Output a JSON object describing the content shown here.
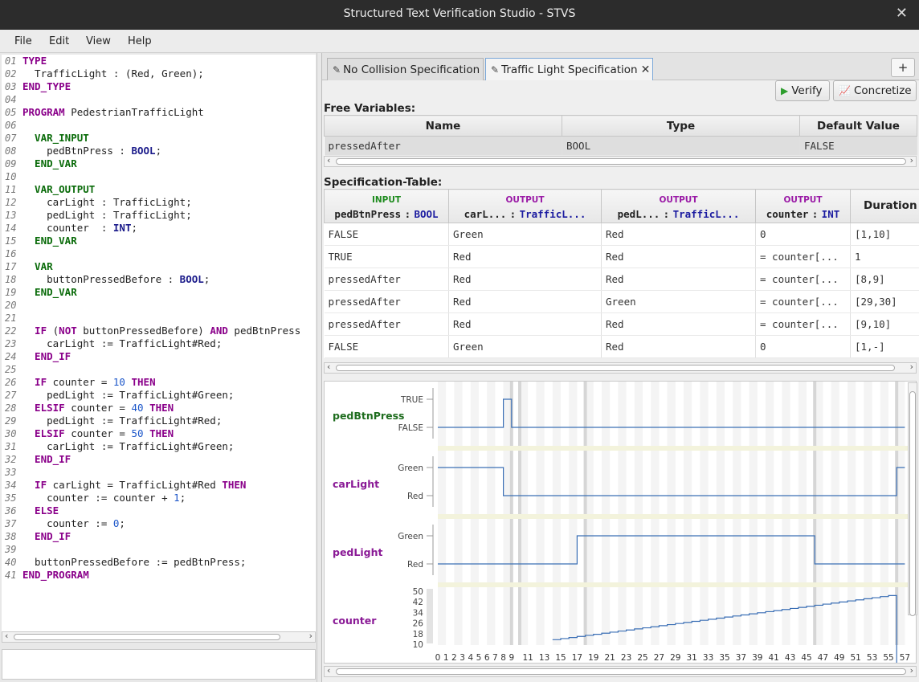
{
  "window": {
    "title": "Structured Text Verification Studio - STVS",
    "close_glyph": "✕"
  },
  "menu": [
    "File",
    "Edit",
    "View",
    "Help"
  ],
  "editor": {
    "lines": [
      [
        [
          "kw2",
          "TYPE"
        ]
      ],
      [
        [
          "",
          "  TrafficLight : (Red, Green);"
        ]
      ],
      [
        [
          "kw2",
          "END_TYPE"
        ]
      ],
      [
        [
          "",
          ""
        ]
      ],
      [
        [
          "kw2",
          "PROGRAM "
        ],
        [
          "",
          "PedestrianTrafficLight"
        ]
      ],
      [
        [
          "",
          ""
        ]
      ],
      [
        [
          "kw",
          "  VAR_INPUT"
        ]
      ],
      [
        [
          "",
          "    pedBtnPress : "
        ],
        [
          "ty",
          "BOOL"
        ],
        [
          "",
          ";"
        ]
      ],
      [
        [
          "kw",
          "  END_VAR"
        ]
      ],
      [
        [
          "",
          ""
        ]
      ],
      [
        [
          "kw",
          "  VAR_OUTPUT"
        ]
      ],
      [
        [
          "",
          "    carLight : TrafficLight;"
        ]
      ],
      [
        [
          "",
          "    pedLight : TrafficLight;"
        ]
      ],
      [
        [
          "",
          "    counter  : "
        ],
        [
          "ty",
          "INT"
        ],
        [
          "",
          ";"
        ]
      ],
      [
        [
          "kw",
          "  END_VAR"
        ]
      ],
      [
        [
          "",
          ""
        ]
      ],
      [
        [
          "kw",
          "  VAR"
        ]
      ],
      [
        [
          "",
          "    buttonPressedBefore : "
        ],
        [
          "ty",
          "BOOL"
        ],
        [
          "",
          ";"
        ]
      ],
      [
        [
          "kw",
          "  END_VAR"
        ]
      ],
      [
        [
          "",
          ""
        ]
      ],
      [
        [
          "",
          ""
        ]
      ],
      [
        [
          "kw2",
          "  IF "
        ],
        [
          "",
          "("
        ],
        [
          "kw2",
          "NOT"
        ],
        [
          "",
          " buttonPressedBefore) "
        ],
        [
          "kw2",
          "AND"
        ],
        [
          "",
          " pedBtnPress"
        ]
      ],
      [
        [
          "",
          "    carLight := TrafficLight#Red;"
        ]
      ],
      [
        [
          "kw2",
          "  END_IF"
        ]
      ],
      [
        [
          "",
          ""
        ]
      ],
      [
        [
          "kw2",
          "  IF "
        ],
        [
          "",
          "counter = "
        ],
        [
          "num",
          "10"
        ],
        [
          "kw2",
          " THEN"
        ]
      ],
      [
        [
          "",
          "    pedLight := TrafficLight#Green;"
        ]
      ],
      [
        [
          "kw2",
          "  ELSIF "
        ],
        [
          "",
          "counter = "
        ],
        [
          "num",
          "40"
        ],
        [
          "kw2",
          " THEN"
        ]
      ],
      [
        [
          "",
          "    pedLight := TrafficLight#Red;"
        ]
      ],
      [
        [
          "kw2",
          "  ELSIF "
        ],
        [
          "",
          "counter = "
        ],
        [
          "num",
          "50"
        ],
        [
          "kw2",
          " THEN"
        ]
      ],
      [
        [
          "",
          "    carLight := TrafficLight#Green;"
        ]
      ],
      [
        [
          "kw2",
          "  END_IF"
        ]
      ],
      [
        [
          "",
          ""
        ]
      ],
      [
        [
          "kw2",
          "  IF "
        ],
        [
          "",
          "carLight = TrafficLight#Red "
        ],
        [
          "kw2",
          "THEN"
        ]
      ],
      [
        [
          "",
          "    counter := counter + "
        ],
        [
          "num",
          "1"
        ],
        [
          "",
          ";"
        ]
      ],
      [
        [
          "kw2",
          "  ELSE"
        ]
      ],
      [
        [
          "",
          "    counter := "
        ],
        [
          "num",
          "0"
        ],
        [
          "",
          ";"
        ]
      ],
      [
        [
          "kw2",
          "  END_IF"
        ]
      ],
      [
        [
          "",
          ""
        ]
      ],
      [
        [
          "",
          "  buttonPressedBefore := pedBtnPress;"
        ]
      ],
      [
        [
          "kw2",
          "END_PROGRAM"
        ]
      ]
    ],
    "line_numbers": [
      "01",
      "02",
      "03",
      "04",
      "05",
      "06",
      "07",
      "08",
      "09",
      "10",
      "11",
      "12",
      "13",
      "14",
      "15",
      "16",
      "17",
      "18",
      "19",
      "20",
      "21",
      "22",
      "23",
      "24",
      "25",
      "26",
      "27",
      "28",
      "29",
      "30",
      "31",
      "32",
      "33",
      "34",
      "35",
      "36",
      "37",
      "38",
      "39",
      "40",
      "41"
    ]
  },
  "tabs": [
    {
      "label": "No Collision Specification",
      "active": false
    },
    {
      "label": "Traffic Light Specification",
      "active": true,
      "close": "✕"
    }
  ],
  "tab_add": "+",
  "toolbar": {
    "verify": "Verify",
    "concretize": "Concretize"
  },
  "free_variables": {
    "title": "Free Variables:",
    "headers": [
      "Name",
      "Type",
      "Default Value"
    ],
    "rows": [
      [
        "pressedAfter",
        "BOOL",
        "FALSE"
      ]
    ]
  },
  "spec_table": {
    "title": "Specification-Table:",
    "columns": [
      {
        "category": "INPUT",
        "name": "pedBtnPress",
        "type": "BOOL"
      },
      {
        "category": "OUTPUT",
        "name": "carL...",
        "type": "TrafficL..."
      },
      {
        "category": "OUTPUT",
        "name": "pedL...",
        "type": "TrafficL..."
      },
      {
        "category": "OUTPUT",
        "name": "counter",
        "type": "INT"
      }
    ],
    "duration_header": "Duration",
    "rows": [
      [
        "FALSE",
        "Green",
        "Red",
        "0",
        "[1,10]"
      ],
      [
        "TRUE",
        "Red",
        "Red",
        "= counter[...",
        "1"
      ],
      [
        "pressedAfter",
        "Red",
        "Red",
        "= counter[...",
        "[8,9]"
      ],
      [
        "pressedAfter",
        "Red",
        "Green",
        "= counter[...",
        "[29,30]"
      ],
      [
        "pressedAfter",
        "Red",
        "Red",
        "= counter[...",
        "[9,10]"
      ],
      [
        "FALSE",
        "Green",
        "Red",
        "0",
        "[1,-]"
      ]
    ]
  },
  "timing": {
    "signals": [
      {
        "name": "pedBtnPress",
        "color": "#1f6d1f",
        "top_label": "TRUE",
        "bottom_label": "FALSE"
      },
      {
        "name": "carLight",
        "color": "#8a1a96",
        "top_label": "Green",
        "bottom_label": "Red"
      },
      {
        "name": "pedLight",
        "color": "#8a1a96",
        "top_label": "Green",
        "bottom_label": "Red"
      },
      {
        "name": "counter",
        "color": "#8a1a96",
        "y_ticks": [
          "50",
          "42",
          "34",
          "26",
          "18",
          "10"
        ]
      }
    ],
    "x_ticks": [
      "0",
      "1",
      "2",
      "3",
      "4",
      "5",
      "6",
      "7",
      "8",
      "9",
      "11",
      "13",
      "15",
      "17",
      "19",
      "21",
      "23",
      "25",
      "27",
      "29",
      "31",
      "33",
      "35",
      "37",
      "39",
      "41",
      "43",
      "45",
      "47",
      "49",
      "51",
      "53",
      "55",
      "57"
    ],
    "wave_color": "#3b6fb5"
  }
}
